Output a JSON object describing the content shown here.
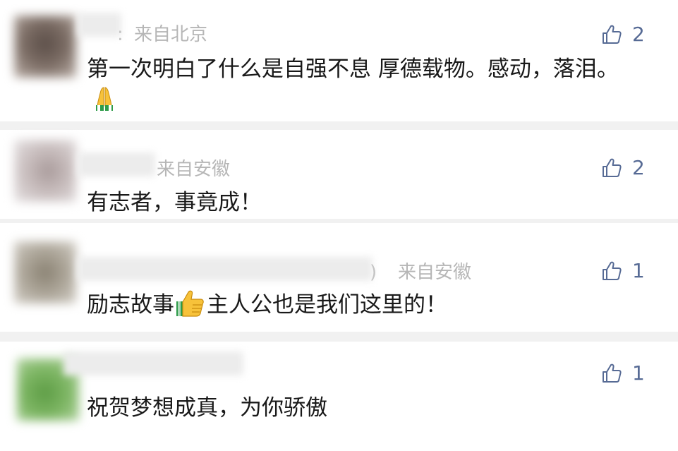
{
  "comments": [
    {
      "location": "来自北京",
      "name_tail": ":",
      "likes": "2",
      "text": "第一次明白了什么是自强不息 厚德载物。感动，落泪。",
      "emoji": "folded-hands-emoji"
    },
    {
      "location": "来自安徽",
      "likes": "2",
      "text": "有志者，事竟成！"
    },
    {
      "location": "来自安徽",
      "name_tail": ")",
      "likes": "1",
      "text_before": "励志故事",
      "emoji": "thumbs-up-emoji",
      "text_after": "主人公也是我们这里的！"
    },
    {
      "likes": "1",
      "text": "祝贺梦想成真，为你骄傲"
    }
  ],
  "like_icon": "thumbs-up-outline-icon",
  "colors": {
    "link_blue": "#576b95",
    "meta_gray": "#b6b6b6",
    "body_text": "#191919"
  }
}
